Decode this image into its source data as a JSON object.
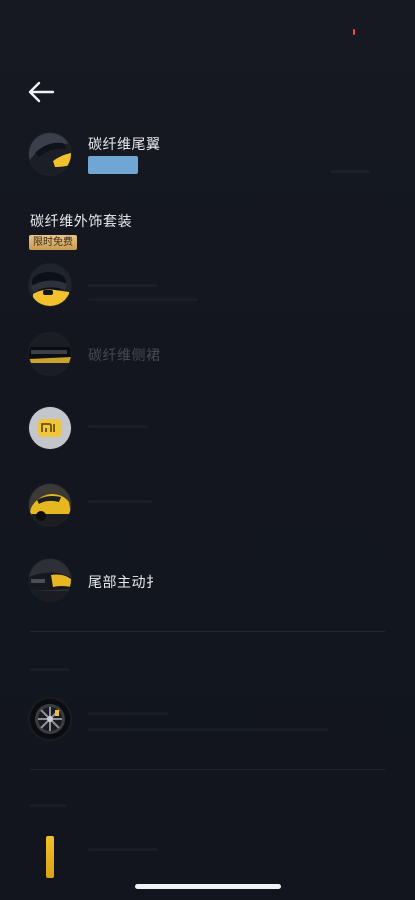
{
  "header": {
    "back_icon": "arrow-left-icon"
  },
  "featured_item": {
    "title": "碳纤维尾翼",
    "thumbnail_icon": "spoiler-thumbnail-icon",
    "price_color": "#6fa6d4"
  },
  "section": {
    "title": "碳纤维外饰套装",
    "badge": "限时免费"
  },
  "list": [
    {
      "title": "",
      "thumbnail_icon": "mirror-thumbnail-icon"
    },
    {
      "title": "碳纤维侧裙",
      "thumbnail_icon": "side-skirt-thumbnail-icon"
    },
    {
      "title": "",
      "thumbnail_icon": "mi-logo-thumbnail-icon"
    },
    {
      "title": "",
      "thumbnail_icon": "front-car-thumbnail-icon"
    },
    {
      "title": "尾部主动扌",
      "thumbnail_icon": "rear-car-thumbnail-icon"
    }
  ],
  "wheel_item": {
    "thumbnail_icon": "wheel-thumbnail-icon"
  },
  "colors": {
    "accent_yellow": "#f2c12b",
    "badge_gold": "#d9b070",
    "background": "#13161f"
  }
}
